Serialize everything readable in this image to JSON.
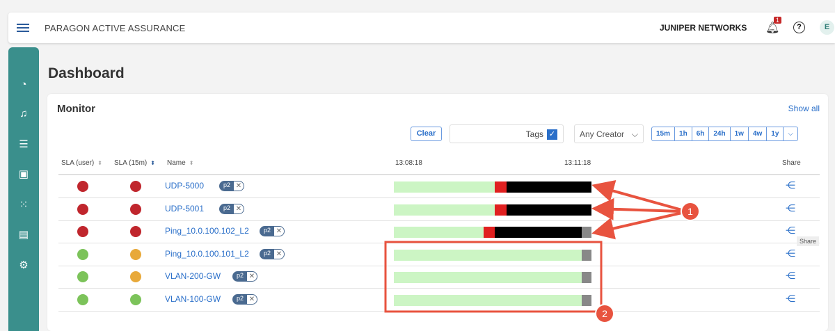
{
  "header": {
    "app_title": "PARAGON ACTIVE ASSURANCE",
    "brand": "JUNIPER NETWORKS",
    "notification_count": "1",
    "help": "?",
    "avatar": "E"
  },
  "page_title": "Dashboard",
  "monitor": {
    "title": "Monitor",
    "show_all": "Show all",
    "clear": "Clear",
    "tags_label": "Tags",
    "tags_checked": true,
    "creator": "Any Creator",
    "ranges": [
      "15m",
      "1h",
      "6h",
      "24h",
      "1w",
      "4w",
      "1y",
      "⌵"
    ],
    "columns": {
      "sla_user": "SLA (user)",
      "sla_15m": "SLA (15m)",
      "name": "Name",
      "time_start": "13:08:18",
      "time_mid": "13:11:18",
      "share": "Share"
    },
    "rows": [
      {
        "name": "UDP-5000",
        "tag": "p2",
        "sla_user": "red",
        "sla_15m": "red",
        "segments": [
          [
            "green",
            51
          ],
          [
            "red",
            6
          ],
          [
            "black",
            43
          ]
        ]
      },
      {
        "name": "UDP-5001",
        "tag": "p2",
        "sla_user": "red",
        "sla_15m": "red",
        "segments": [
          [
            "green",
            51
          ],
          [
            "red",
            6
          ],
          [
            "black",
            43
          ]
        ]
      },
      {
        "name": "Ping_10.0.100.102_L2",
        "tag": "p2",
        "sla_user": "red",
        "sla_15m": "red",
        "segments": [
          [
            "green",
            45.5
          ],
          [
            "red",
            5.5
          ],
          [
            "black",
            44
          ],
          [
            "gray",
            5
          ]
        ]
      },
      {
        "name": "Ping_10.0.100.101_L2",
        "tag": "p2",
        "sla_user": "green",
        "sla_15m": "orange",
        "segments": [
          [
            "green",
            95
          ],
          [
            "gray",
            5
          ]
        ]
      },
      {
        "name": "VLAN-200-GW",
        "tag": "p2",
        "sla_user": "green",
        "sla_15m": "orange",
        "segments": [
          [
            "green",
            95
          ],
          [
            "gray",
            5
          ]
        ]
      },
      {
        "name": "VLAN-100-GW",
        "tag": "p2",
        "sla_user": "green",
        "sla_15m": "green",
        "segments": [
          [
            "green",
            95
          ],
          [
            "gray",
            5
          ]
        ]
      }
    ],
    "share_tooltip": "Share"
  },
  "annotations": [
    "1",
    "2"
  ],
  "colors": {
    "red": "#c0262d",
    "green": "#7cc35a",
    "orange": "#e8a93a",
    "black": "#000000",
    "gray": "#888888",
    "bar_green": "#ccf5c4",
    "bar_red": "#e02020"
  }
}
